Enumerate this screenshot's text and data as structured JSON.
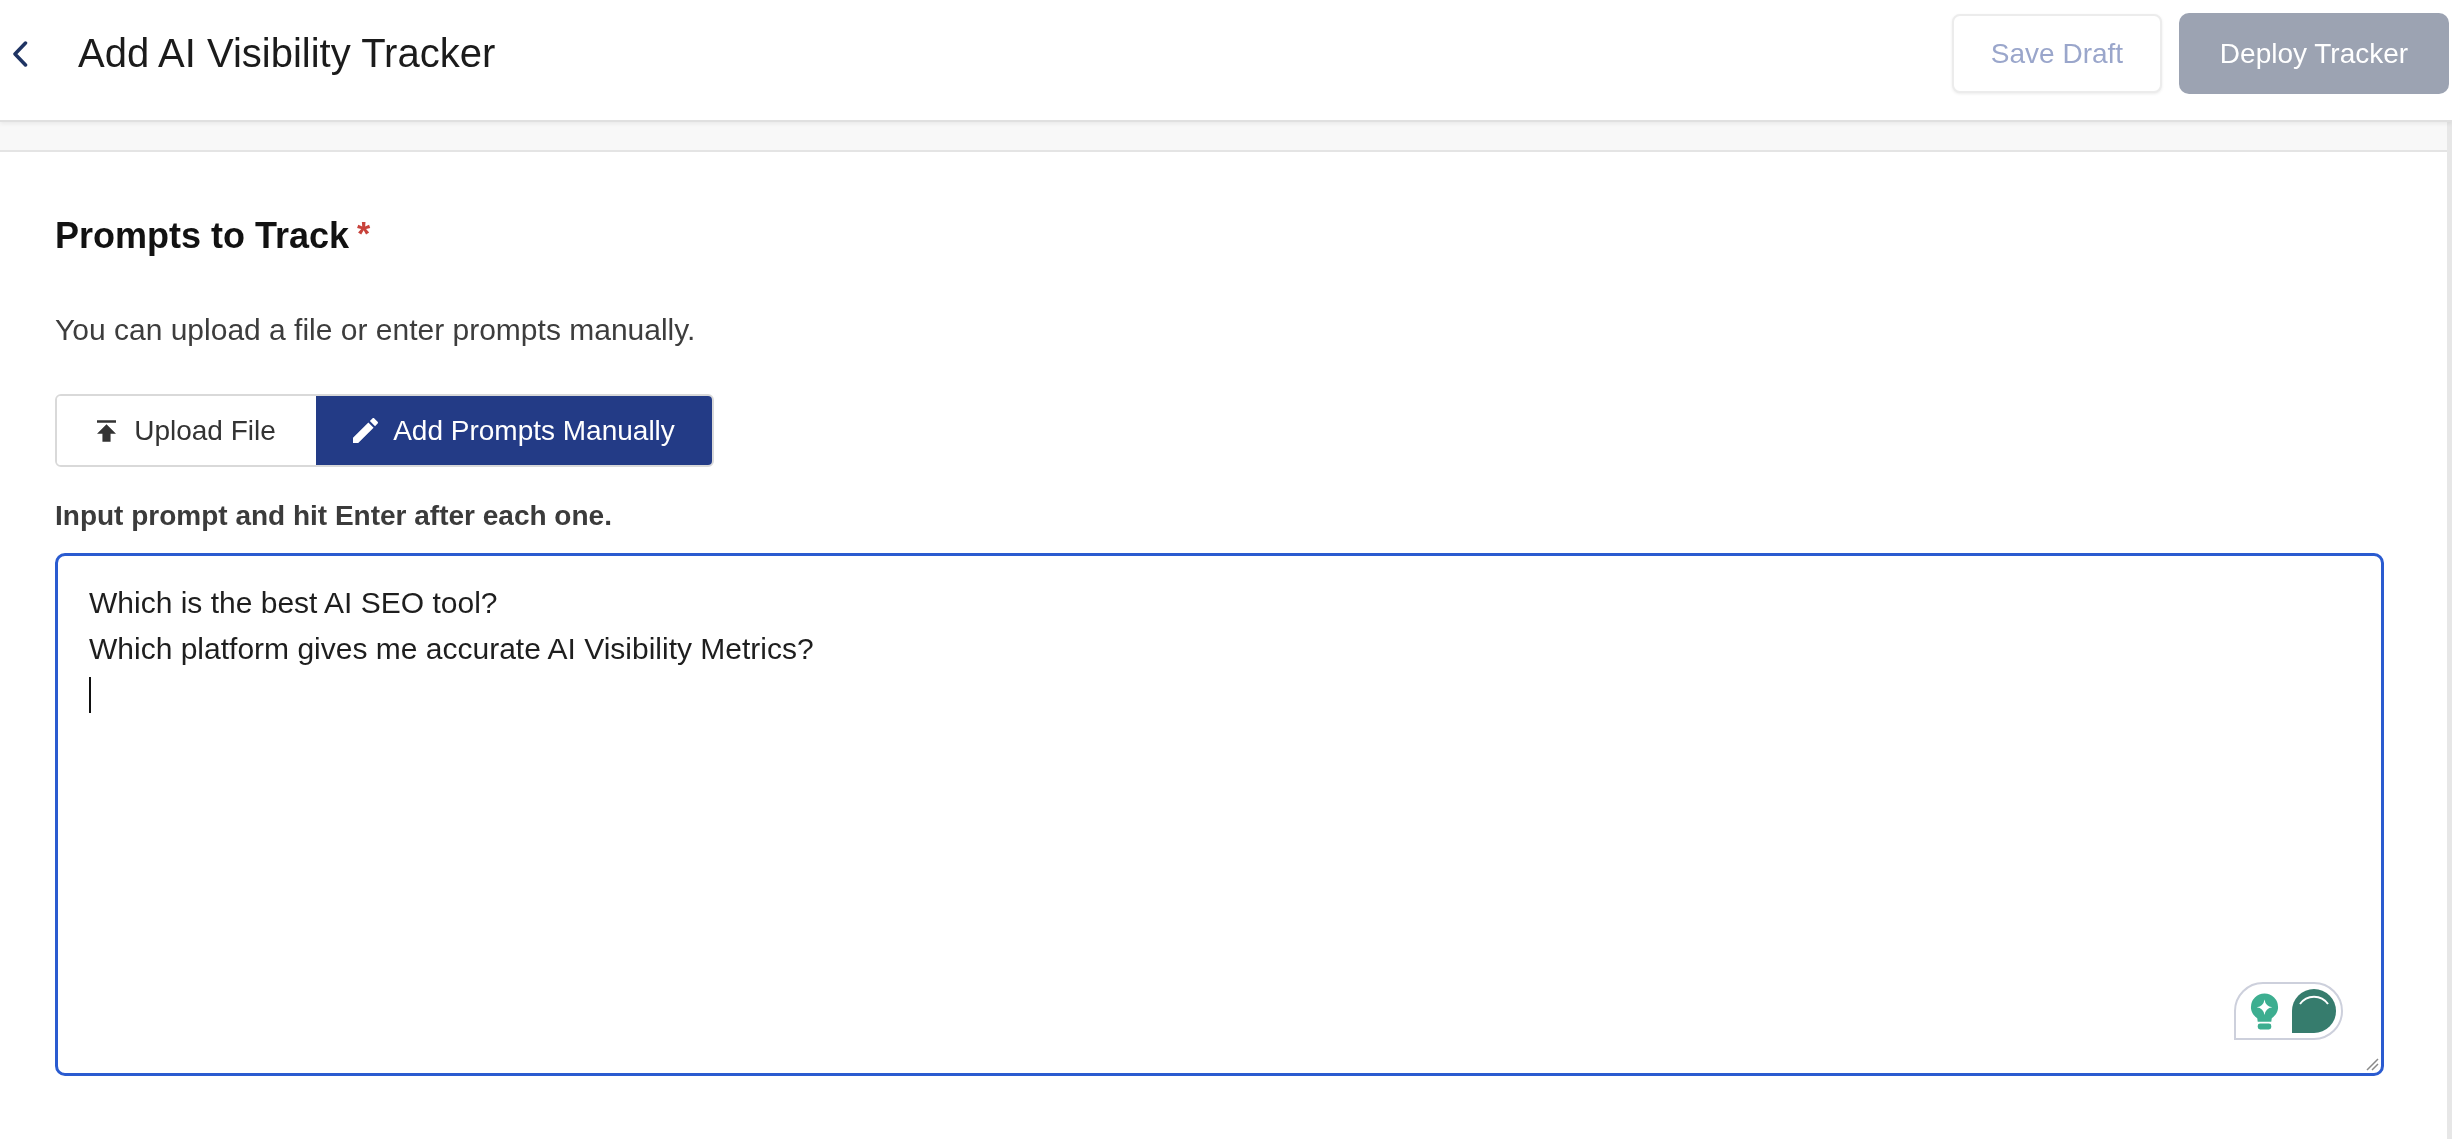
{
  "header": {
    "title": "Add AI Visibility Tracker",
    "buttons": [
      {
        "label": "Save Draft",
        "kind": "outline",
        "disabled": true
      },
      {
        "label": "Deploy Tracker",
        "kind": "primary",
        "disabled": true
      }
    ]
  },
  "section": {
    "title": "Prompts to Track",
    "required_mark": "*",
    "description": "You can upload a file or enter prompts manually.",
    "mode_tabs": [
      {
        "label": "Upload File",
        "kind": "upload",
        "selected": false
      },
      {
        "label": "Add Prompts Manually",
        "kind": "manual",
        "selected": true
      }
    ],
    "field_label": "Input prompt and hit Enter after each one.",
    "prompt_field": {
      "lines": [
        "Which is the best AI SEO tool?",
        "Which platform gives me accurate AI Visibility Metrics?"
      ],
      "focused": true
    }
  }
}
